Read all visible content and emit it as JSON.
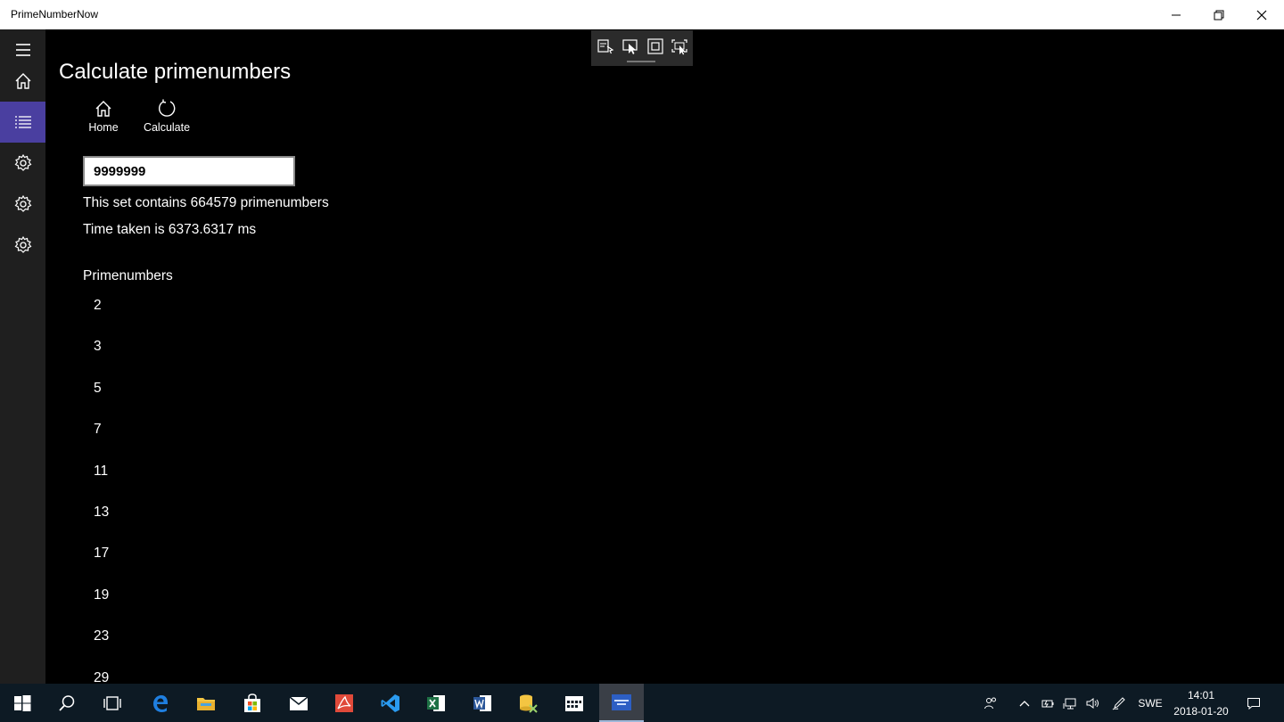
{
  "window": {
    "title": "PrimeNumberNow"
  },
  "page": {
    "title": "Calculate primenumbers"
  },
  "commands": {
    "home_label": "Home",
    "calculate_label": "Calculate"
  },
  "input": {
    "value": "9999999"
  },
  "results": {
    "count_text": "This set contains 664579 primenumbers",
    "time_text": "Time taken is 6373.6317 ms"
  },
  "list": {
    "header": "Primenumbers",
    "items": [
      "2",
      "3",
      "5",
      "7",
      "11",
      "13",
      "17",
      "19",
      "23",
      "29"
    ]
  },
  "taskbar": {
    "language": "SWE",
    "time": "14:01",
    "date": "2018-01-20"
  },
  "colors": {
    "nav_selected": "#4a3fa0",
    "nav_background": "#1f1f1f",
    "content_background": "#000000",
    "taskbar_background": "#0d1a24"
  }
}
